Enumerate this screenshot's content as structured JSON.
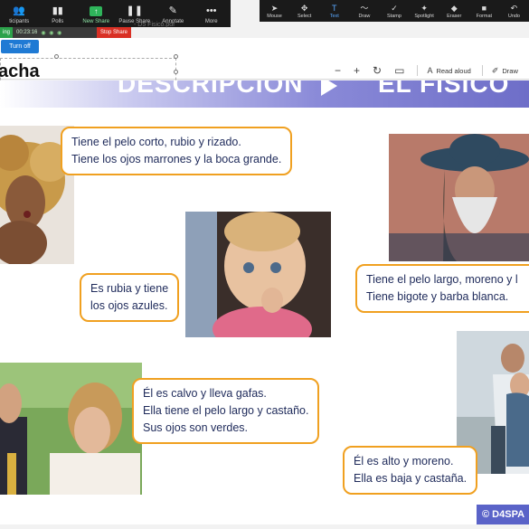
{
  "zoom_toolbar": {
    "items": [
      {
        "label": "ticipants",
        "badge": "2",
        "icon": "participants-icon"
      },
      {
        "label": "Polls",
        "icon": "polls-icon"
      },
      {
        "label": "New Share",
        "icon": "new-share-icon"
      },
      {
        "label": "Pause Share",
        "icon": "pause-icon"
      },
      {
        "label": "Annotate",
        "icon": "annotate-icon"
      },
      {
        "label": "More",
        "icon": "more-icon"
      }
    ]
  },
  "annotation_toolbar": {
    "items": [
      {
        "label": "Mouse",
        "icon": "mouse-pointer-icon"
      },
      {
        "label": "Select",
        "icon": "select-icon"
      },
      {
        "label": "Text",
        "icon": "text-icon"
      },
      {
        "label": "Draw",
        "icon": "draw-icon"
      },
      {
        "label": "Stamp",
        "icon": "stamp-icon"
      },
      {
        "label": "Spotlight",
        "icon": "spotlight-icon"
      },
      {
        "label": "Eraser",
        "icon": "eraser-icon"
      },
      {
        "label": "Format",
        "icon": "format-icon"
      },
      {
        "label": "Undo",
        "icon": "undo-icon"
      }
    ]
  },
  "status": {
    "recording": "ing",
    "timer": "00:23:16",
    "stop_label": "Stop Share"
  },
  "document_title": "- D5 Fisico.pdf",
  "pdf_header": {
    "turn_off_label": "Turn off",
    "typed_name": "acha",
    "read_aloud": "Read aloud",
    "draw": "Draw"
  },
  "slide": {
    "banner_left": "DESCRIPCIÓN",
    "banner_right": "EL FÍSICO",
    "bubbles": [
      {
        "lines": [
          "Tiene el pelo corto, rubio y rizado.",
          "Tiene los ojos marrones y la boca grande."
        ]
      },
      {
        "lines": [
          "Es rubia y tiene",
          "los ojos azules."
        ]
      },
      {
        "lines": [
          "Tiene el pelo largo, moreno y l",
          "Tiene bigote y barba blanca."
        ]
      },
      {
        "lines": [
          "Él es calvo y lleva gafas.",
          "Ella tiene el pelo largo y castaño.",
          "Sus ojos son verdes."
        ]
      },
      {
        "lines": [
          "Él es alto y moreno.",
          "Ella es baja y castaña."
        ]
      }
    ],
    "logo": "D4SPA"
  },
  "colors": {
    "bubble_border": "#f0a020",
    "text": "#1e2a5a",
    "accent": "#5a63c8"
  }
}
